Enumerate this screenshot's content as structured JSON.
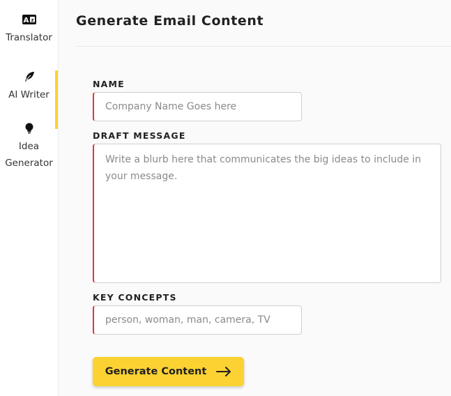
{
  "sidebar": {
    "items": [
      {
        "label": "Translator",
        "icon": "translate-icon",
        "active": false
      },
      {
        "label": "AI Writer",
        "icon": "feather-icon",
        "active": true
      },
      {
        "label": "Idea Generator",
        "icon": "lightbulb-icon",
        "active": false
      }
    ]
  },
  "main": {
    "title": "Generate Email Content",
    "form": {
      "name": {
        "label": "NAME",
        "placeholder": "Company Name Goes here",
        "value": ""
      },
      "draft": {
        "label": "DRAFT MESSAGE",
        "placeholder": "Write a blurb here that communicates the big ideas to include in your message.",
        "value": ""
      },
      "concepts": {
        "label": "KEY CONCEPTS",
        "placeholder": "person, woman, man, camera, TV",
        "value": ""
      },
      "submit_label": "Generate Content",
      "submit_icon": "arrow-right-icon"
    }
  },
  "colors": {
    "accent": "#fcd232",
    "required_border": "#d9363e",
    "text": "#212121"
  }
}
